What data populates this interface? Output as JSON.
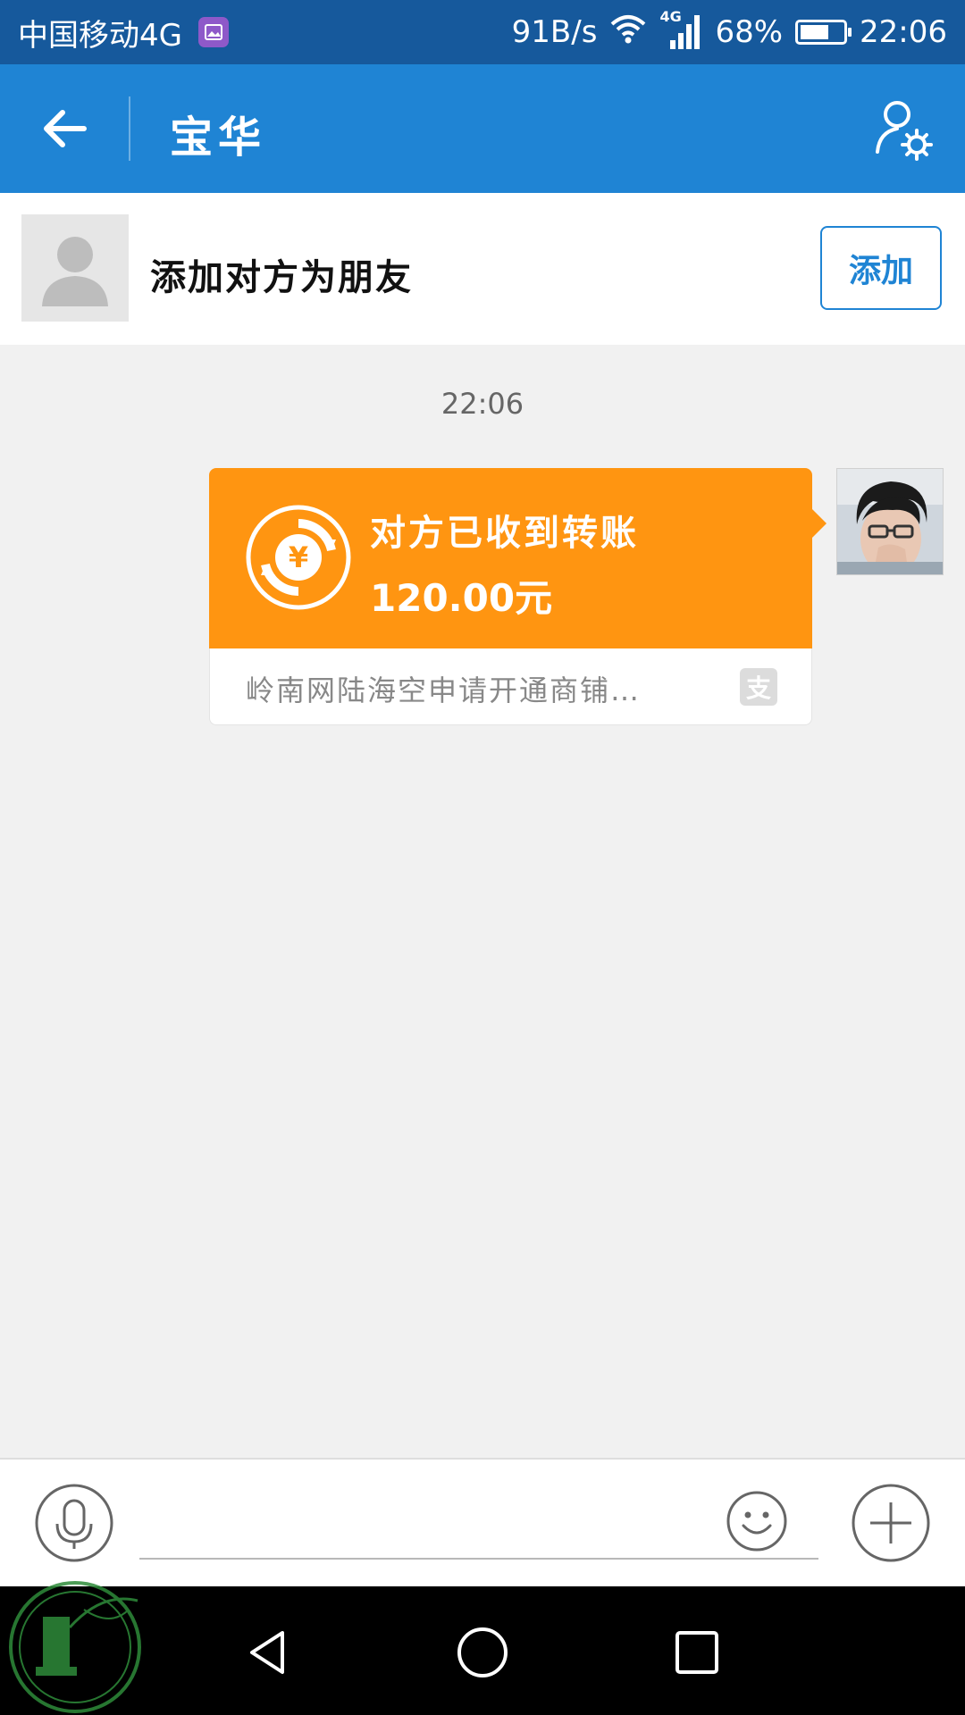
{
  "status_bar": {
    "carrier": "中国移动4G",
    "speed": "91B/s",
    "network": "4G",
    "battery": "68%",
    "battery_level": 0.68,
    "time": "22:06"
  },
  "header": {
    "title": "宝华"
  },
  "add_friend": {
    "text": "添加对方为朋友",
    "button_label": "添加"
  },
  "chat": {
    "timestamp": "22:06",
    "transfer": {
      "title": "对方已收到转账",
      "amount": "120.00元",
      "description": "岭南网陆海空申请开通商铺…",
      "source_icon": "支"
    }
  },
  "input": {
    "placeholder": ""
  },
  "colors": {
    "status_bar": "#16599c",
    "app_bar": "#1f84d4",
    "transfer_card": "#ff9511",
    "background": "#f1f1f1"
  },
  "icons": [
    "back-arrow-icon",
    "user-settings-icon",
    "default-avatar-icon",
    "yen-transfer-icon",
    "alipay-icon",
    "microphone-icon",
    "emoji-icon",
    "plus-icon",
    "nav-back-icon",
    "nav-home-icon",
    "nav-recents-icon"
  ]
}
